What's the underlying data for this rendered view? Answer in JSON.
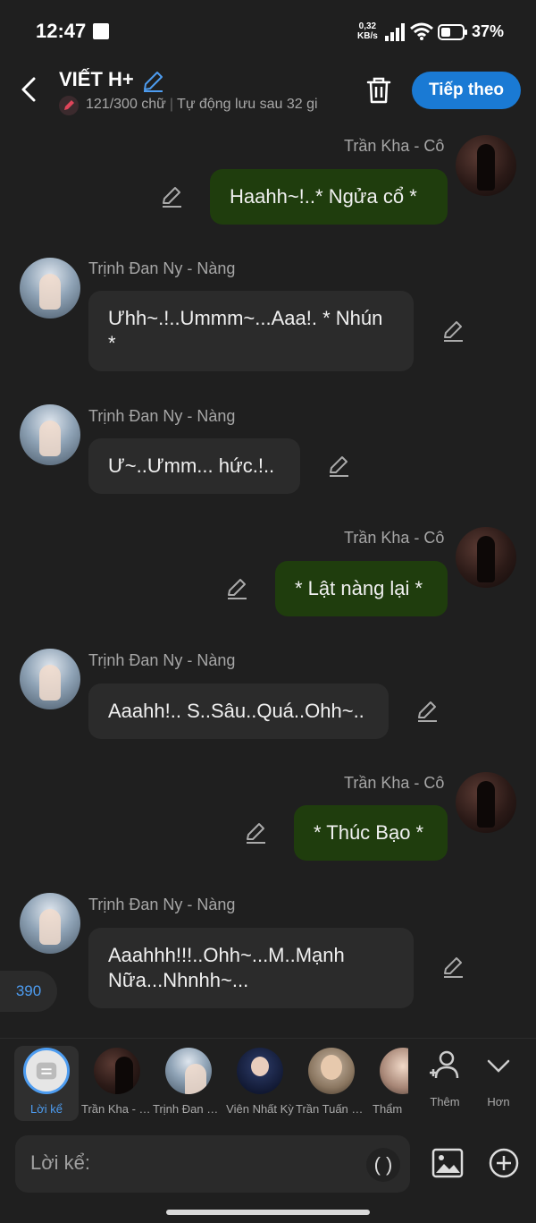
{
  "status": {
    "time": "12:47",
    "speed_value": "0,32",
    "speed_unit": "KB/s",
    "battery": "37%"
  },
  "header": {
    "title": "VIẾT H+",
    "word_count": "121/300 chữ",
    "autosave": "Tự động lưu sau 32 gi",
    "next_label": "Tiếp theo"
  },
  "messages": [
    {
      "sender": "Trần Kha - Cô",
      "text": "Haahh~!..* Ngửa cổ *"
    },
    {
      "sender": "Trịnh Đan Ny - Nàng",
      "text": "Ưhh~.!..Ummm~...Aaa!. * Nhún *"
    },
    {
      "sender": "Trịnh Đan Ny - Nàng",
      "text": "Ư~..Ưmm... hức.!.."
    },
    {
      "sender": "Trần Kha - Cô",
      "text": "* Lật nàng lại *"
    },
    {
      "sender": "Trịnh Đan Ny - Nàng",
      "text": "Aaahh!.. S..Sâu..Quá..Ohh~.."
    },
    {
      "sender": "Trần Kha - Cô",
      "text": "* Thúc Bạo *"
    },
    {
      "sender": "Trịnh Đan Ny - Nàng",
      "text": "Aaahhh!!!..Ohh~...M..Mạnh Nữa...Nhnhh~..."
    }
  ],
  "count_badge": "390",
  "characters": [
    {
      "label": "Lời kể"
    },
    {
      "label": "Trần Kha - Cô"
    },
    {
      "label": "Trịnh Đan Ny - Nàng"
    },
    {
      "label": "Viên Nhất Kỳ"
    },
    {
      "label": "Trần Tuấn Kiệt"
    },
    {
      "label": "Thẩm"
    }
  ],
  "more_actions": {
    "add_label": "Thêm",
    "more_label": "Hơn"
  },
  "composer": {
    "placeholder": "Lời kể:",
    "paren_label": "( )"
  },
  "colors": {
    "accent": "#1a7ad4",
    "outgoing_bubble": "#1f3d0d",
    "incoming_bubble": "#2b2b2b",
    "background": "#1f1f1f"
  }
}
